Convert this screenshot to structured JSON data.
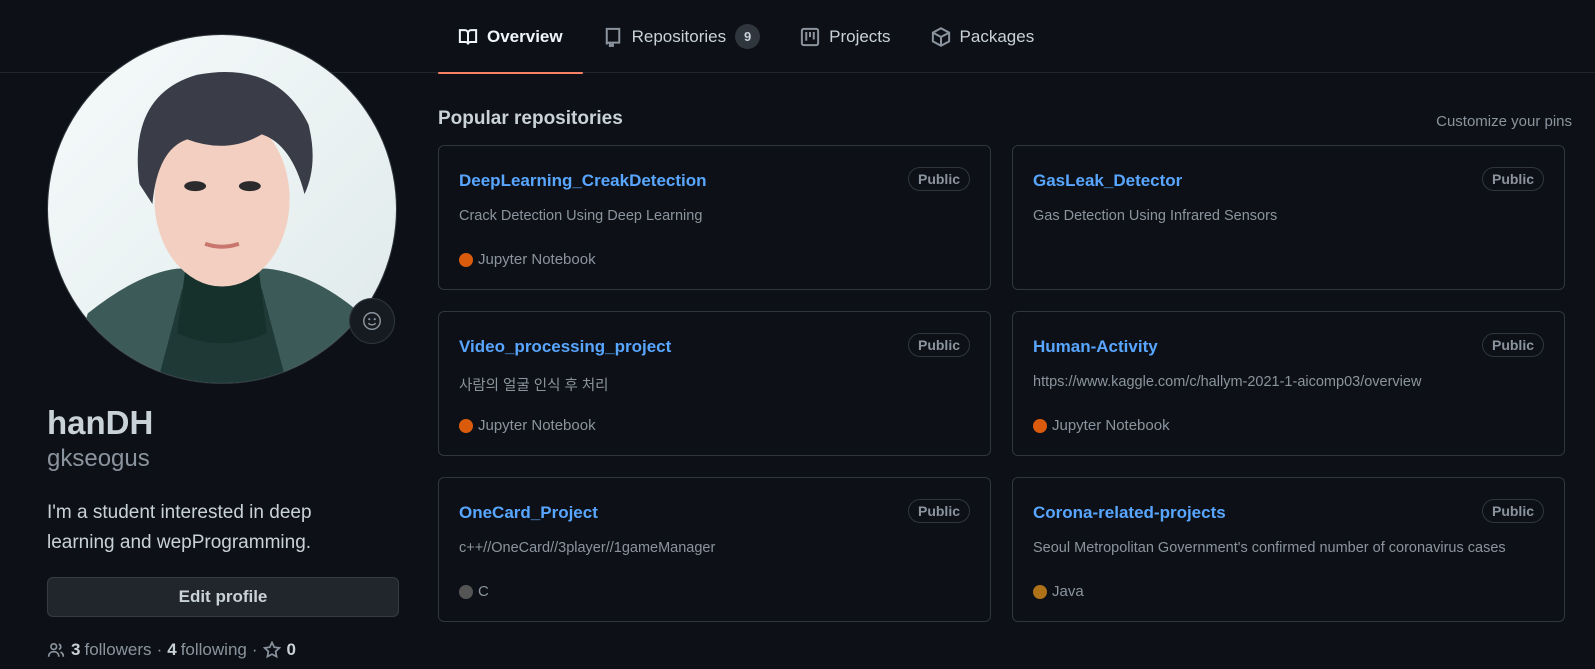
{
  "tabs": [
    {
      "label": "Overview",
      "icon": "book-icon",
      "active": true
    },
    {
      "label": "Repositories",
      "icon": "repo-icon",
      "count": "9"
    },
    {
      "label": "Projects",
      "icon": "project-icon"
    },
    {
      "label": "Packages",
      "icon": "package-icon"
    }
  ],
  "profile": {
    "fullname": "hanDH",
    "username": "gkseogus",
    "bio": "I'm a student interested in deep learning and wepProgramming.",
    "edit_label": "Edit profile",
    "followers_count": "3",
    "followers_label": "followers",
    "following_count": "4",
    "following_label": "following",
    "stars_count": "0",
    "sep": "·"
  },
  "pinned": {
    "title": "Popular repositories",
    "customize_label": "Customize your pins",
    "repos": [
      {
        "name": "DeepLearning_CreakDetection",
        "visibility": "Public",
        "description": "Crack Detection Using Deep Learning",
        "language": "Jupyter Notebook",
        "lang_color": "#DA5B0B"
      },
      {
        "name": "GasLeak_Detector",
        "visibility": "Public",
        "description": "Gas Detection Using Infrared Sensors",
        "language": "",
        "lang_color": ""
      },
      {
        "name": "Video_processing_project",
        "visibility": "Public",
        "description": "사람의 얼굴 인식 후 처리",
        "language": "Jupyter Notebook",
        "lang_color": "#DA5B0B"
      },
      {
        "name": "Human-Activity",
        "visibility": "Public",
        "description": "https://www.kaggle.com/c/hallym-2021-1-aicomp03/overview",
        "language": "Jupyter Notebook",
        "lang_color": "#DA5B0B"
      },
      {
        "name": "OneCard_Project",
        "visibility": "Public",
        "description": "c++//OneCard//3player//1gameManager",
        "language": "C",
        "lang_color": "#555555"
      },
      {
        "name": "Corona-related-projects",
        "visibility": "Public",
        "description": "Seoul Metropolitan Government's confirmed number of coronavirus cases",
        "language": "Java",
        "lang_color": "#b07219"
      }
    ]
  },
  "colors": {
    "background": "#0d1117",
    "link": "#58a6ff",
    "tab_underline": "#f78166",
    "muted": "#8b949e"
  }
}
